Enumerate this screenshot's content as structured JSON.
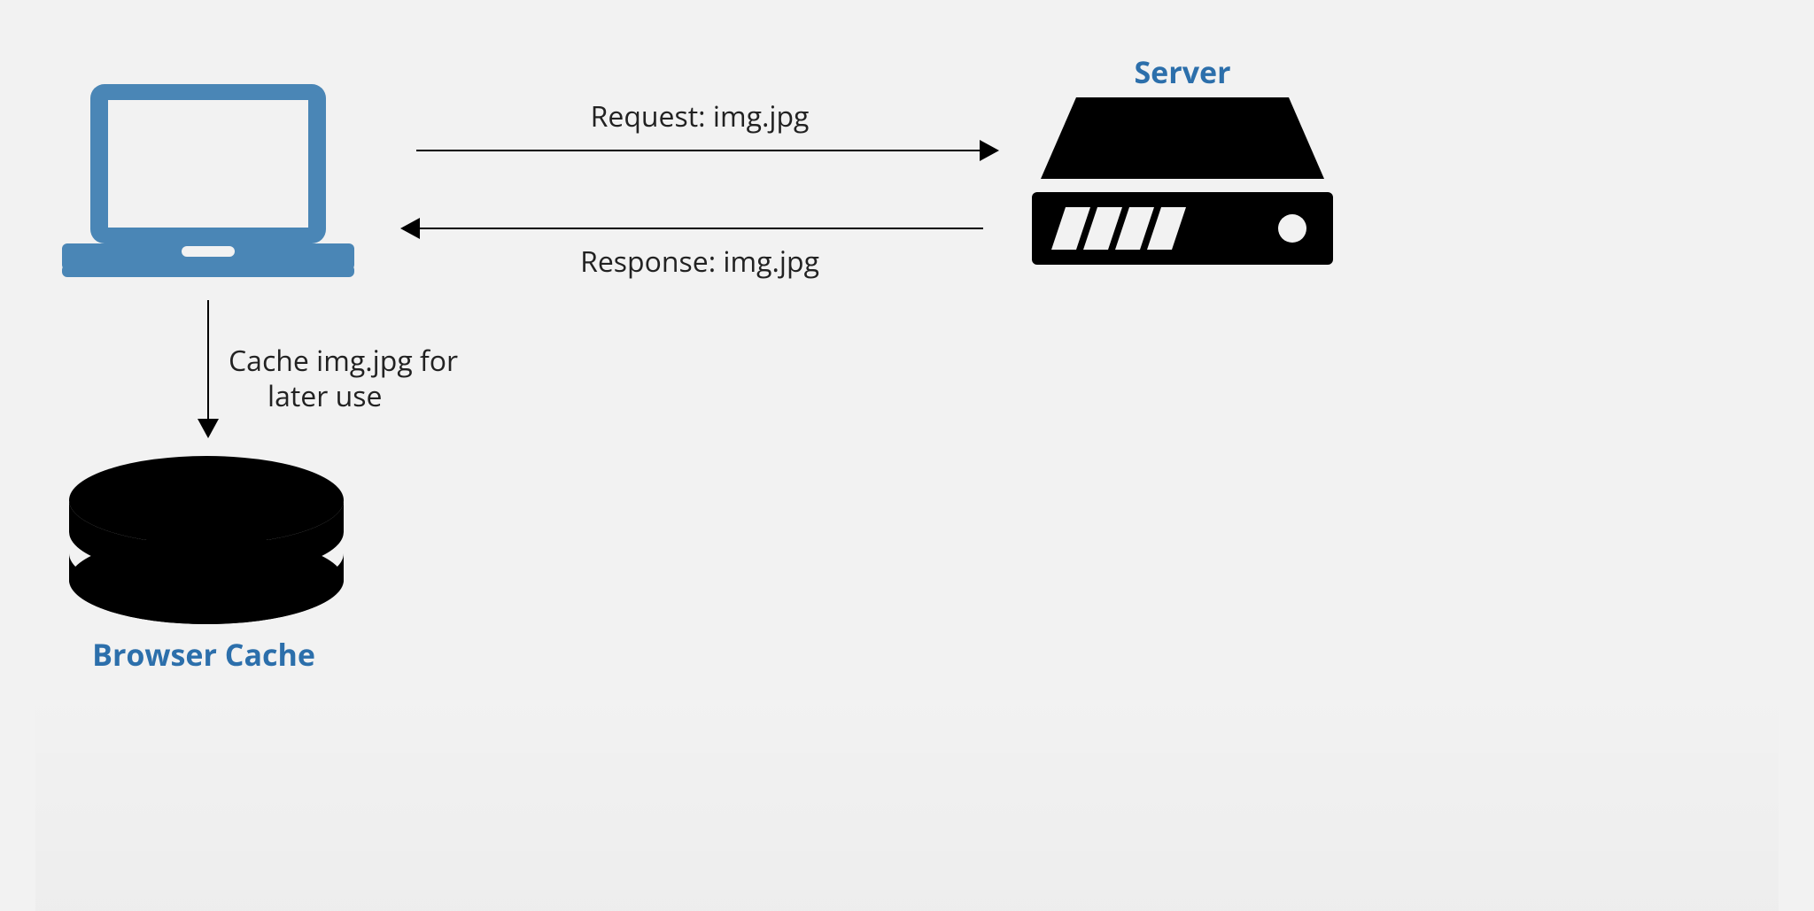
{
  "server_heading": "Server",
  "cache_heading": "Browser Cache",
  "request_label": "Request: img.jpg",
  "response_label": "Response: img.jpg",
  "cache_label_line1": "Cache img.jpg for",
  "cache_label_line2": "later use",
  "colors": {
    "accent_blue": "#4a86b6",
    "heading_blue": "#2c6fab",
    "black": "#000000",
    "bg": "#f2f2f2"
  },
  "nodes": [
    {
      "id": "client",
      "type": "laptop"
    },
    {
      "id": "server",
      "type": "server"
    },
    {
      "id": "browser_cache",
      "type": "cache_disk"
    }
  ],
  "edges": [
    {
      "from": "client",
      "to": "server",
      "label_key": "request_label"
    },
    {
      "from": "server",
      "to": "client",
      "label_key": "response_label"
    },
    {
      "from": "client",
      "to": "browser_cache",
      "label_key": "cache_label"
    }
  ]
}
